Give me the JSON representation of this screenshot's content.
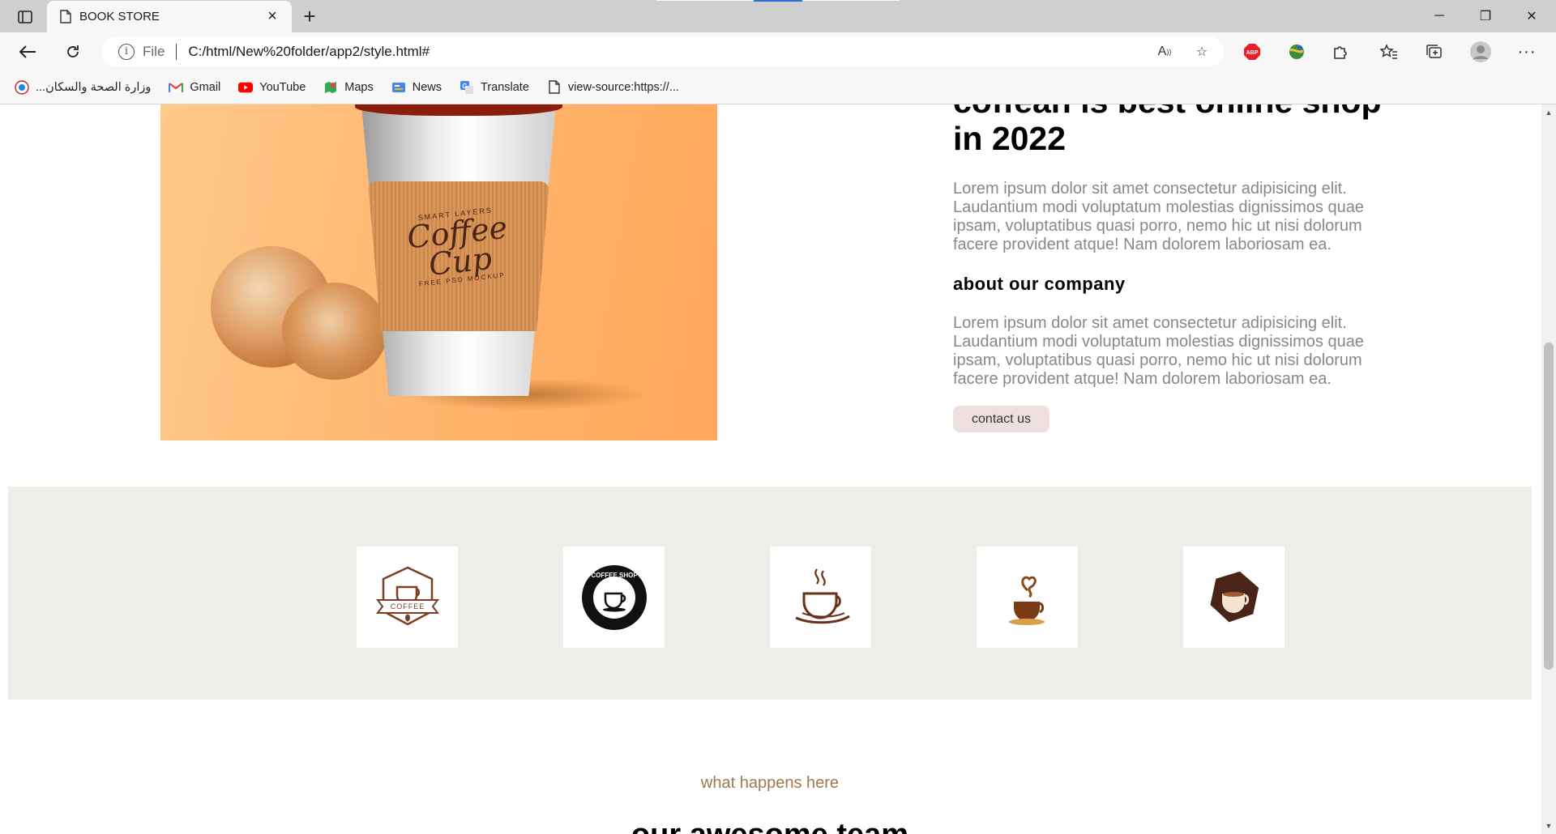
{
  "browser": {
    "tab_title": "BOOK STORE",
    "new_tab": "+",
    "address": {
      "scheme": "File",
      "url": "C:/html/New%20folder/app2/style.html#"
    },
    "window_controls": {
      "minimize": "─",
      "restore": "❐",
      "close": "✕"
    },
    "bookmarks": [
      {
        "label": "...وزارة الصحة والسكان",
        "icon": "moh-icon"
      },
      {
        "label": "Gmail",
        "icon": "gmail-icon"
      },
      {
        "label": "YouTube",
        "icon": "youtube-icon"
      },
      {
        "label": "Maps",
        "icon": "maps-icon"
      },
      {
        "label": "News",
        "icon": "news-icon"
      },
      {
        "label": "Translate",
        "icon": "translate-icon"
      },
      {
        "label": "view-source:https://...",
        "icon": "page-icon"
      }
    ]
  },
  "hero": {
    "image_text": {
      "top": "SMART LAYERS",
      "brand": "Coffee Cup",
      "bottom": "FREE PSD MOCKUP"
    },
    "headline_line1": "coffeah is best online shop",
    "headline_line2": "in 2022",
    "paragraph1": "Lorem ipsum dolor sit amet consectetur adipisicing elit. Laudantium modi voluptatum molestias dignissimos quae ipsam, voluptatibus quasi porro, nemo hic ut nisi dolorum facere provident atque! Nam dolorem laboriosam ea.",
    "subheading": "about our company",
    "paragraph2": "Lorem ipsum dolor sit amet consectetur adipisicing elit. Laudantium modi voluptatum molestias dignissimos quae ipsam, voluptatibus quasi porro, nemo hic ut nisi dolorum facere provident atque! Nam dolorem laboriosam ea.",
    "cta_label": "contact us"
  },
  "logos": [
    {
      "icon": "coffee-ribbon-logo",
      "text": "COFFEE"
    },
    {
      "icon": "coffee-shop-seal-logo",
      "text": "COFFEE SHOP"
    },
    {
      "icon": "steaming-cup-logo"
    },
    {
      "icon": "heart-steam-cup-logo"
    },
    {
      "icon": "hexagon-cup-logo"
    }
  ],
  "team_section": {
    "eyebrow": "what happens here",
    "title": "our awesome team"
  },
  "colors": {
    "accent_brown": "#a0784e",
    "band_bg": "#eeede8",
    "cta_bg": "#eedfdf",
    "hero_orange": "#ffb46c"
  }
}
